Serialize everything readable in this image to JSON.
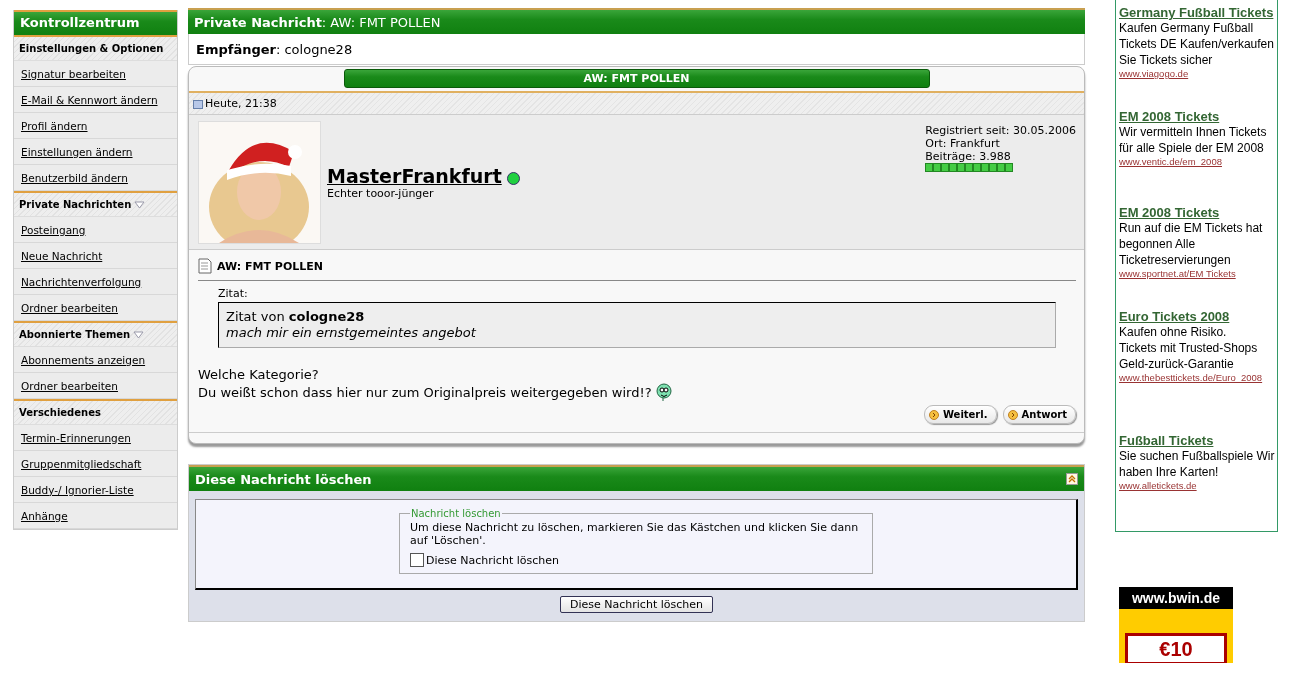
{
  "sidebar": {
    "title": "Kontrollzentrum",
    "groups": [
      {
        "title": "Einstellungen & Optionen",
        "collapsible": false,
        "items": [
          "Signatur bearbeiten",
          "E-Mail & Kennwort ändern",
          "Profil ändern",
          "Einstellungen ändern",
          "Benutzerbild ändern"
        ]
      },
      {
        "title": "Private Nachrichten",
        "collapsible": true,
        "items": [
          "Posteingang",
          "Neue Nachricht",
          "Nachrichtenverfolgung",
          "Ordner bearbeiten"
        ]
      },
      {
        "title": "Abonnierte Themen",
        "collapsible": true,
        "items": [
          "Abonnements anzeigen",
          "Ordner bearbeiten"
        ]
      },
      {
        "title": "Verschiedenes",
        "collapsible": false,
        "items": [
          "Termin-Erinnerungen",
          "Gruppenmitgliedschaft",
          "Buddy-/ Ignorier-Liste",
          "Anhänge"
        ]
      }
    ]
  },
  "page_title": "**Private Nachricht**: AW: FMT POLLEN",
  "recipient": "**Empfänger**: cologne28",
  "message": {
    "title": "AW: FMT POLLEN",
    "date": "Heute, 21:38",
    "author": "MasterFrankfurt",
    "online": true,
    "user_title": "Echter tooor-jünger",
    "user_info": [
      "Registriert seit: 30.05.2006",
      "Ort: Frankfurt",
      "Beiträge: 3.988"
    ],
    "subject": "AW: FMT POLLEN",
    "quote_label": "Zitat:",
    "quote_by": "Zitat von **cologne28**",
    "quote_text": "mach mir ein ernstgemeintes angebot",
    "body": [
      "Welche Kategorie?",
      "Du weißt schon dass hier nur zum Originalpreis weitergegeben wird!?"
    ],
    "buttons": [
      "Weiterl.",
      "Antwort"
    ]
  },
  "delete_panel": {
    "title": "Diese Nachricht löschen",
    "legend": "Nachricht löschen",
    "text": "Um diese Nachricht zu löschen, markieren Sie das Kästchen und klicken Sie dann auf 'Löschen'.",
    "checkbox": {
      "label": "Diese Nachricht löschen",
      "checked": false
    },
    "button": "Diese Nachricht löschen"
  },
  "ads": [
    {
      "title": "Germany Fußball Tickets",
      "lines": [
        "Kaufen Germany Fußball Tickets DE Kaufen/verkaufen Sie Tickets sicher"
      ],
      "url": "www.viagogo.de"
    },
    {
      "title": "EM 2008 Tickets",
      "lines": [
        "Wir vermitteln Ihnen Tickets für alle Spiele der EM 2008"
      ],
      "url": "www.ventic.de/em_2008"
    },
    {
      "title": "EM 2008 Tickets",
      "lines": [
        "Run auf die EM Tickets hat begonnen Alle Ticketreservierungen"
      ],
      "url": "www.sportnet.at/EM Tickets"
    },
    {
      "title": "Euro Tickets 2008",
      "lines": [
        "Kaufen ohne Risiko.",
        "Tickets mit Trusted-Shops Geld-zurück-Garantie"
      ],
      "url": "www.thebesttickets.de/Euro_2008"
    },
    {
      "title": "Fußball Tickets",
      "lines": [
        "Sie suchen Fußballspiele Wir haben Ihre Karten!"
      ],
      "url": "www.alletickets.de"
    }
  ],
  "banner": {
    "site": "www.bwin.de",
    "amount": "€10"
  }
}
